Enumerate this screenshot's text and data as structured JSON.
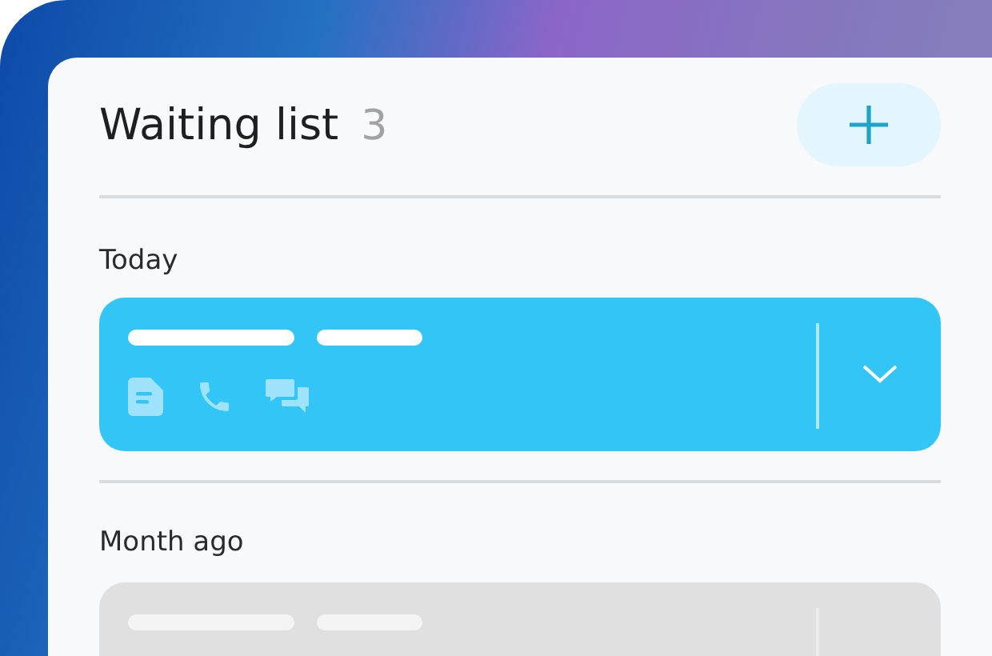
{
  "header": {
    "title": "Waiting list",
    "count": "3"
  },
  "groups": [
    {
      "label": "Today",
      "card": {
        "selected": true
      }
    },
    {
      "label": "Month ago",
      "card": {
        "selected": false
      }
    }
  ]
}
